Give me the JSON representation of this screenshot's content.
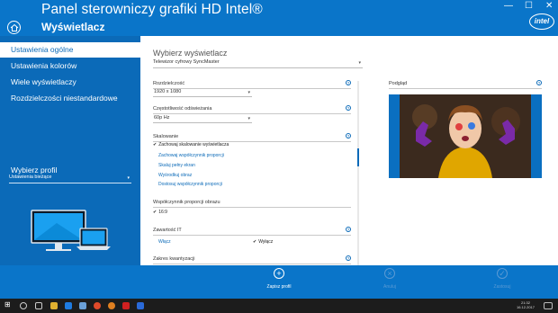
{
  "header": {
    "title": "Panel sterowniczy grafiki HD Intel®",
    "subtitle": "Wyświetlacz",
    "logo_text": "intel",
    "min": "—",
    "max": "☐",
    "close": "✕"
  },
  "sidebar": {
    "items": [
      {
        "label": "Ustawienia ogólne",
        "active": true
      },
      {
        "label": "Ustawienia kolorów",
        "active": false
      },
      {
        "label": "Wiele wyświetlaczy",
        "active": false
      },
      {
        "label": "Rozdzielczości niestandardowe",
        "active": false
      }
    ],
    "profile_label": "Wybierz profil",
    "profile_value": "Ustawienia bieżące"
  },
  "main": {
    "select_display_title": "Wybierz wyświetlacz",
    "display_value": "Telewizor cyfrowy SyncMaster",
    "resolution_label": "Rozdzielczość",
    "resolution_value": "1920 x 1080",
    "refresh_label": "Częstotliwość odświeżania",
    "refresh_value": "60p Hz",
    "scaling_label": "Skalowanie",
    "scaling_options": [
      "Zachowaj skalowanie wyświetlacza",
      "Zachowaj współczynnik proporcji",
      "Skaluj pełny ekran",
      "Wyśrodkuj obraz",
      "Dostosuj współczynnik proporcji"
    ],
    "aspect_label": "Współczynnik proporcji obrazu",
    "aspect_value": "16:9",
    "it_label": "Zawartość IT",
    "it_on": "Włącz",
    "it_off": "Wyłącz",
    "quant_label": "Zakres kwantyzacji",
    "preview_label": "Podgląd",
    "info": "?"
  },
  "actions": {
    "save": "Zapisz profil",
    "cancel": "Anuluj",
    "apply": "Zastosuj"
  },
  "taskbar": {
    "time": "21:32",
    "date": "16.12.2017"
  },
  "colors": {
    "accent": "#0a75c9",
    "sidebar": "#0b6ab8"
  }
}
